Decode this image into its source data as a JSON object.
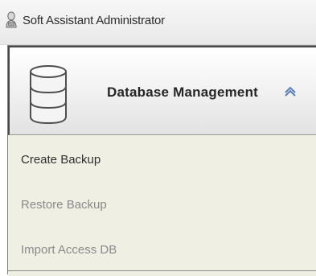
{
  "window": {
    "title": "Soft Assistant Administrator",
    "icon": "app-user-icon"
  },
  "panel": {
    "title": "Database Management",
    "icon": "database-icon",
    "collapse_icon": "chevron-up-icon",
    "items": [
      {
        "label": "Create Backup",
        "enabled": true
      },
      {
        "label": "Restore Backup",
        "enabled": false
      },
      {
        "label": "Import Access DB",
        "enabled": false
      }
    ]
  },
  "colors": {
    "panel_background": "#f0efe4",
    "disabled_text": "#8a8a8a",
    "text": "#2f2f2f"
  }
}
